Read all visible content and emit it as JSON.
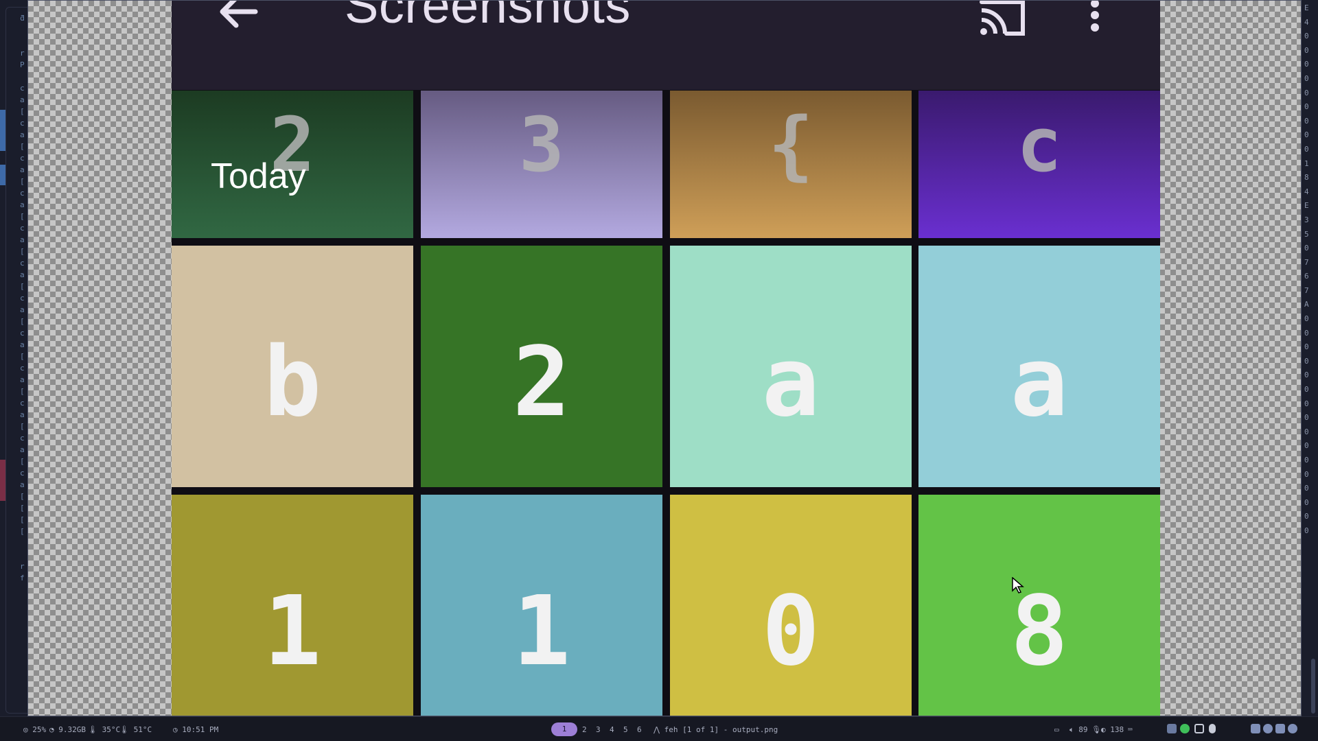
{
  "left_terminal": {
    "glyphs": "ƌ\n\n\nr\nP\n\nc\na\n[\nc\na\n[\nc\na\n[\nc\na\n[\nc\na\n[\nc\na\n[\nc\na\n[\nc\na\n[\nc\na\n[\nc\na\n[\nc\na\n[\nc\na\n[\n[\n[\n[\n\n\nr\nf\n"
  },
  "right_terminal": {
    "column": "E\n4\n0\n0\n0\n0\n0\n0\n0\n0\n0\n1\n8\n4\nE\n3\n5\n0\n7\n6\n7\nA\n0\n0\n0\n0\n0\n0\n0\n0\n0\n0\n0\n0\n0\n0\n0\n0"
  },
  "app": {
    "title": "Screenshots",
    "back_icon": "arrow-back-icon",
    "cast_icon": "cast-icon",
    "more_icon": "more-vert-icon",
    "section_label": "Today"
  },
  "tiles": [
    {
      "glyph": "2",
      "color_top": "#1c3b22",
      "color_bottom": "#316843"
    },
    {
      "glyph": "3",
      "color_top": "#665b82",
      "color_bottom": "#b3a9e0"
    },
    {
      "glyph": "{",
      "color_top": "#7a5a30",
      "color_bottom": "#cf9f58"
    },
    {
      "glyph": "c",
      "color_top": "#3a1a6e",
      "color_bottom": "#6a2fd0"
    },
    {
      "glyph": "b",
      "color": "#d2c1a2"
    },
    {
      "glyph": "2",
      "color": "#367426"
    },
    {
      "glyph": "a",
      "color": "#9edec6"
    },
    {
      "glyph": "a",
      "color": "#93ced8"
    },
    {
      "glyph": "1",
      "color": "#a09831"
    },
    {
      "glyph": "1",
      "color": "#6aaebe"
    },
    {
      "glyph": "0",
      "color": "#cfbf43"
    },
    {
      "glyph": "8",
      "color": "#63c347"
    }
  ],
  "statusbar": {
    "cpu": "25%",
    "mem": "9.32GB",
    "temp1": "35°C",
    "temp2": "51°C",
    "clock": "10:51 PM",
    "workspaces": [
      "1",
      "2",
      "3",
      "4",
      "5",
      "6"
    ],
    "active_workspace": "1",
    "window_title": "feh [1 of 1] - output.png",
    "volume": "89",
    "brightness": "138"
  }
}
